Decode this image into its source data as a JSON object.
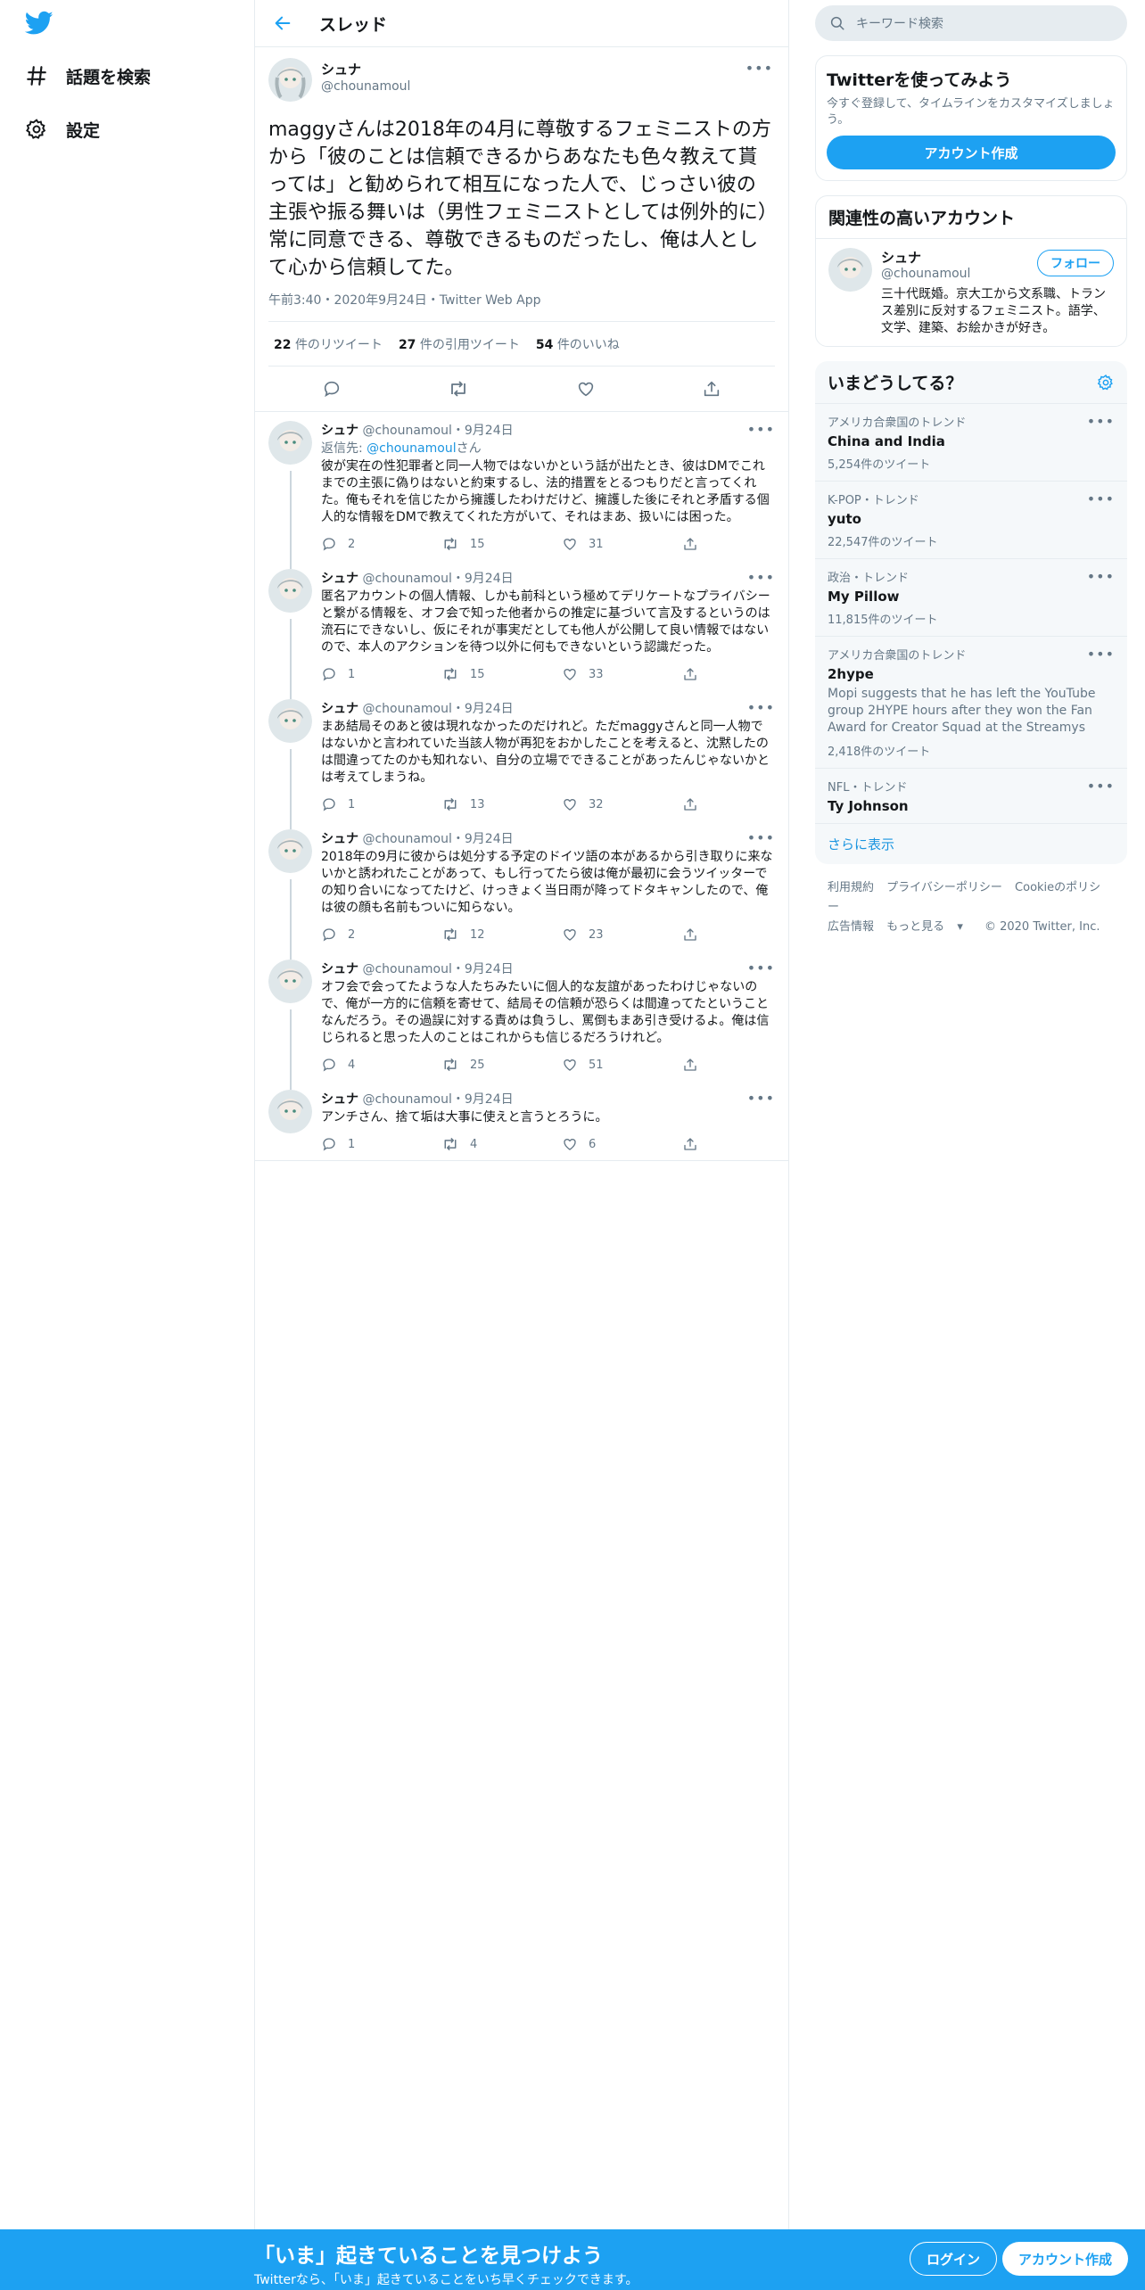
{
  "nav": {
    "explore_label": "話題を検索",
    "settings_label": "設定"
  },
  "header": {
    "title": "スレッド"
  },
  "focal": {
    "name": "シュナ",
    "handle": "@chounamoul",
    "text": "maggyさんは2018年の4月に尊敬するフェミニストの方から「彼のことは信頼できるからあなたも色々教えて貰っては」と勧められて相互になった人で、じっさい彼の主張や振る舞いは（男性フェミニストとしては例外的に）常に同意できる、尊敬できるものだったし、俺は人として心から信頼してた。",
    "meta": "午前3:40・2020年9月24日・Twitter Web App",
    "retweets_count": "22",
    "retweets_label": "件のリツイート",
    "quotes_count": "27",
    "quotes_label": "件の引用ツイート",
    "likes_count": "54",
    "likes_label": "件のいいね"
  },
  "replies": [
    {
      "name": "シュナ",
      "handle": "@chounamoul",
      "date": "・9月24日",
      "replying_prefix": "返信先: ",
      "replying_handle": "@chounamoul",
      "replying_suffix": "さん",
      "text": "彼が実在の性犯罪者と同一人物ではないかという話が出たとき、彼はDMでこれまでの主張に偽りはないと約束するし、法的措置をとるつもりだと言ってくれた。俺もそれを信じたから擁護したわけだけど、擁護した後にそれと矛盾する個人的な情報をDMで教えてくれた方がいて、それはまあ、扱いには困った。",
      "replies": "2",
      "retweets": "15",
      "likes": "31"
    },
    {
      "name": "シュナ",
      "handle": "@chounamoul",
      "date": "・9月24日",
      "text": "匿名アカウントの個人情報、しかも前科という極めてデリケートなプライバシーと繋がる情報を、オフ会で知った他者からの推定に基づいて言及するというのは流石にできないし、仮にそれが事実だとしても他人が公開して良い情報ではないので、本人のアクションを待つ以外に何もできないという認識だった。",
      "replies": "1",
      "retweets": "15",
      "likes": "33"
    },
    {
      "name": "シュナ",
      "handle": "@chounamoul",
      "date": "・9月24日",
      "text": "まあ結局そのあと彼は現れなかったのだけれど。ただmaggyさんと同一人物ではないかと言われていた当該人物が再犯をおかしたことを考えると、沈黙したのは間違ってたのかも知れない、自分の立場でできることがあったんじゃないかとは考えてしまうね。",
      "replies": "1",
      "retweets": "13",
      "likes": "32"
    },
    {
      "name": "シュナ",
      "handle": "@chounamoul",
      "date": "・9月24日",
      "text": "2018年の9月に彼からは処分する予定のドイツ語の本があるから引き取りに来ないかと誘われたことがあって、もし行ってたら彼は俺が最初に会うツイッターでの知り合いになってたけど、けっきょく当日雨が降ってドタキャンしたので、俺は彼の顔も名前もついに知らない。",
      "replies": "2",
      "retweets": "12",
      "likes": "23"
    },
    {
      "name": "シュナ",
      "handle": "@chounamoul",
      "date": "・9月24日",
      "text": "オフ会で会ってたような人たちみたいに個人的な友誼があったわけじゃないので、俺が一方的に信頼を寄せて、結局その信頼が恐らくは間違ってたということなんだろう。その過誤に対する責めは負うし、罵倒もまあ引き受けるよ。俺は信じられると思った人のことはこれからも信じるだろうけれど。",
      "replies": "4",
      "retweets": "25",
      "likes": "51"
    },
    {
      "name": "シュナ",
      "handle": "@chounamoul",
      "date": "・9月24日",
      "text": "アンチさん、捨て垢は大事に使えと言うとろうに。",
      "replies": "1",
      "retweets": "4",
      "likes": "6"
    }
  ],
  "side": {
    "search_placeholder": "キーワード検索",
    "signup": {
      "title": "Twitterを使ってみよう",
      "desc": "今すぐ登録して、タイムラインをカスタマイズしましょう。",
      "button": "アカウント作成"
    },
    "relevant": {
      "title": "関連性の高いアカウント",
      "name": "シュナ",
      "handle": "@chounamoul",
      "follow": "フォロー",
      "bio": "三十代既婚。京大工から文系職、トランス差別に反対するフェミニスト。語学、文学、建築、お絵かきが好き。"
    },
    "trends": {
      "title": "いまどうしてる？",
      "items": [
        {
          "context": "アメリカ合衆国のトレンド",
          "name": "China and India",
          "count": "5,254件のツイート"
        },
        {
          "context": "K-POP・トレンド",
          "name": "yuto",
          "count": "22,547件のツイート"
        },
        {
          "context": "政治・トレンド",
          "name": "My Pillow",
          "count": "11,815件のツイート"
        },
        {
          "context": "アメリカ合衆国のトレンド",
          "name": "2hype",
          "desc": "Mopi suggests that he has left the YouTube group 2HYPE hours after they won the Fan Award for Creator Squad at the Streamys",
          "count": "2,418件のツイート"
        },
        {
          "context": "NFL・トレンド",
          "name": "Ty Johnson"
        }
      ],
      "show_more": "さらに表示"
    },
    "footer": {
      "terms": "利用規約",
      "privacy": "プライバシーポリシー",
      "cookie": "Cookieのポリシー",
      "ads": "広告情報",
      "more": "もっと見る",
      "copyright": "© 2020 Twitter, Inc."
    }
  },
  "bottombar": {
    "headline": "「いま」起きていることを見つけよう",
    "sub": "Twitterなら、「いま」起きていることをいち早くチェックできます。",
    "login": "ログイン",
    "signup": "アカウント作成"
  },
  "colors": {
    "accent": "#1da1f2",
    "secondary_text": "#657786",
    "border": "#e6ecf0"
  }
}
